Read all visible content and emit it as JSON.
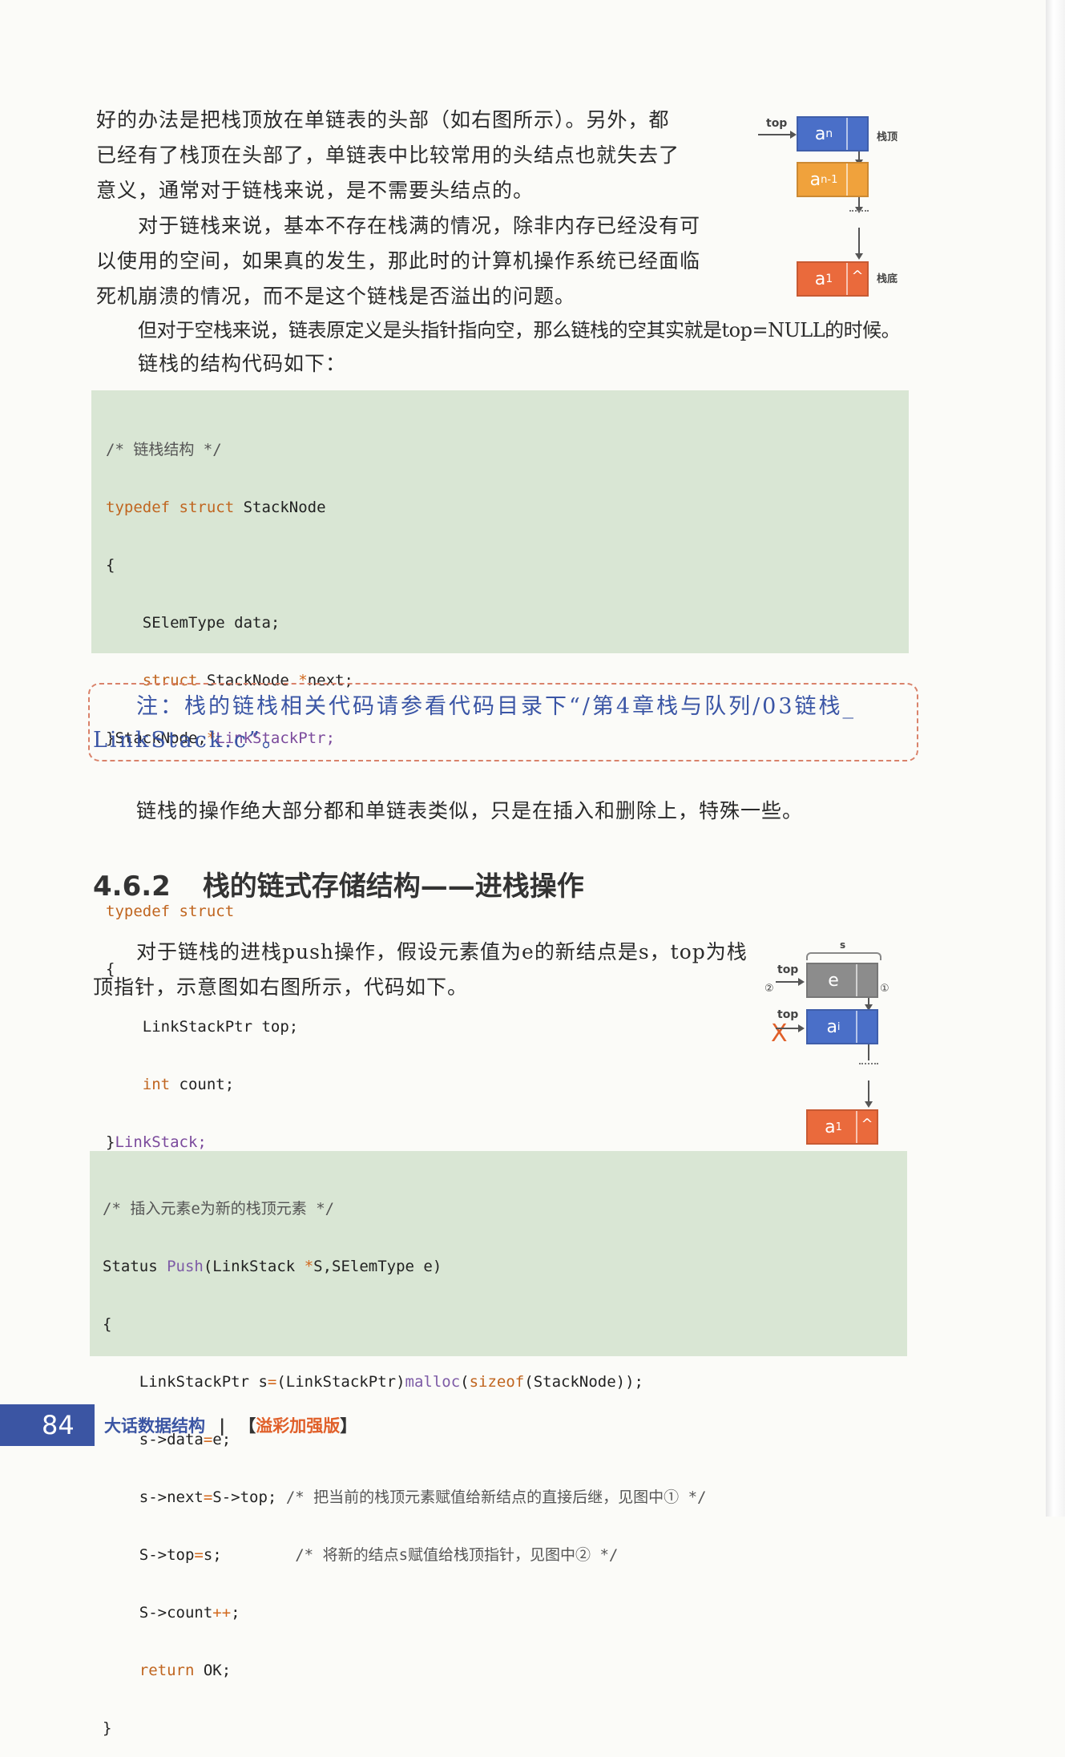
{
  "paragraphs": {
    "p1_line1": "好的办法是把栈顶放在单链表的头部（如右图所示）。另外，都",
    "p1_line2": "已经有了栈顶在头部了，单链表中比较常用的头结点也就失去了",
    "p1_line3": "意义，通常对于链栈来说，是不需要头结点的。",
    "p2_line1": "对于链栈来说，基本不存在栈满的情况，除非内存已经没有可",
    "p2_line2": "以使用的空间，如果真的发生，那此时的计算机操作系统已经面临",
    "p2_line3": "死机崩溃的情况，而不是这个链栈是否溢出的问题。",
    "p3": "但对于空栈来说，链表原定义是头指针指向空，那么链栈的空其实就是top=NULL的时候。",
    "p4": "链栈的结构代码如下：",
    "p5": "链栈的操作绝大部分都和单链表类似，只是在插入和删除上，特殊一些。",
    "p6_line1": "对于链栈的进栈push操作，假设元素值为e的新结点是s，top为栈",
    "p6_line2": "顶指针，示意图如右图所示，代码如下。"
  },
  "code1": {
    "l1": "/* 链栈结构 */",
    "l2a": "typedef struct",
    "l2b": " StackNode",
    "l3": "{",
    "l4": "    SElemType data;",
    "l5a": "    struct",
    "l5b": " StackNode ",
    "l5c": "*",
    "l5d": "next;",
    "l6a": "}StackNode,",
    "l6b": "*",
    "l6c": "LinkStackPtr;",
    "l7": "typedef struct",
    "l8": "{",
    "l9": "    LinkStackPtr top;",
    "l10a": "    int",
    "l10b": " count;",
    "l11a": "}",
    "l11b": "LinkStack;"
  },
  "note": {
    "line1": "注：栈的链栈相关代码请参看代码目录下“/第4章栈与队列/03链栈_",
    "line2": "LinkStack.c”。"
  },
  "section": {
    "number": "4.6.2",
    "title": "栈的链式存储结构——进栈操作"
  },
  "code2": {
    "l1": "/* 插入元素e为新的栈顶元素 */",
    "l2a": "Status ",
    "l2b": "Push",
    "l2c": "(LinkStack ",
    "l2d": "*",
    "l2e": "S,SElemType e)",
    "l3": "{",
    "l4a": "    LinkStackPtr s",
    "l4b": "=",
    "l4c": "(LinkStackPtr)",
    "l4d": "malloc",
    "l4e": "(",
    "l4f": "sizeof",
    "l4g": "(StackNode));",
    "l5a": "    s->data",
    "l5b": "=",
    "l5c": "e;",
    "l6a": "    s->next",
    "l6b": "=",
    "l6c": "S->top;",
    "l6d": " /* 把当前的栈顶元素赋值给新结点的直接后继，见图中① */",
    "l7a": "    S->top",
    "l7b": "=",
    "l7c": "s;",
    "l7d": "        /* 将新的结点s赋值给栈顶指针，见图中② */",
    "l8a": "    S->count",
    "l8b": "++",
    "l8c": ";",
    "l9a": "    return",
    "l9b": " OK;",
    "l10": "}"
  },
  "diagram1": {
    "top_label": "top",
    "node_top": "a",
    "node_top_sub": "n",
    "node_mid": "a",
    "node_mid_sub": "n-1",
    "node_bottom": "a",
    "node_bottom_sub": "1",
    "null_mark": "^",
    "label_top": "栈顶",
    "label_bottom": "栈底"
  },
  "diagram2": {
    "s_label": "s",
    "top_label1": "top",
    "top_label2": "top",
    "node_e": "e",
    "node_ai": "a",
    "node_ai_sub": "i",
    "node_a1": "a",
    "node_a1_sub": "1",
    "null_mark": "^",
    "circle1": "①",
    "circle2": "②",
    "cross": "X"
  },
  "footer": {
    "page_number": "84",
    "book_title": "大话数据结构",
    "separator": "|",
    "edition_open": "【",
    "edition": "溢彩加强版",
    "edition_close": "】"
  },
  "colors": {
    "blue_node": "#4a6fc8",
    "orange_node": "#f0a23c",
    "red_node": "#ea6a3c",
    "gray_node": "#8c8c8c",
    "code_bg": "#d9e6d4",
    "note_border": "#d9826a",
    "note_text": "#3a55a5",
    "footer_blue": "#3b55a3"
  }
}
